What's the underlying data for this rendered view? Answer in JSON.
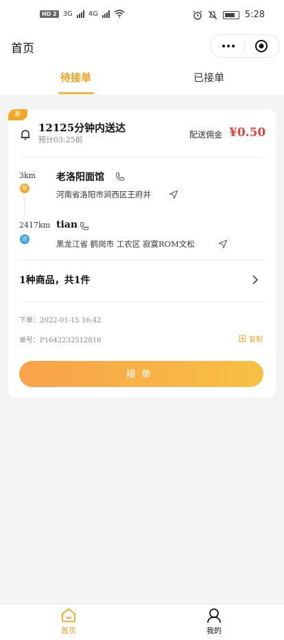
{
  "status_bar": {
    "badge": "HD 2",
    "network_1": "3G",
    "network_2": "4G",
    "time": "5:28"
  },
  "header": {
    "title": "首页"
  },
  "tabs": [
    {
      "label": "待接单",
      "active": true
    },
    {
      "label": "已接单",
      "active": false
    }
  ],
  "order": {
    "new_badge": "新",
    "delivery_title": "12125分钟内送达",
    "eta": "预计03:25前",
    "fee_label": "配送佣金",
    "fee_value": "¥0.50",
    "pickup": {
      "distance": "3km",
      "pin": "取",
      "name": "老洛阳面馆",
      "address": "河南省洛阳市涧西区王府井"
    },
    "dropoff": {
      "distance": "2417km",
      "pin": "达",
      "name": "tian",
      "address": "黑龙江省 鹤岗市 工农区 寂寞ROM文松"
    },
    "goods_summary": "1种商品，共1件",
    "order_time": "下单：2022-01-15 16:42",
    "order_number": "单号：P1642232512816",
    "copy_label": "复制",
    "accept_label": "接单"
  },
  "bottom_nav": [
    {
      "label": "首页",
      "icon": "home-icon",
      "active": true
    },
    {
      "label": "我的",
      "icon": "user-icon",
      "active": false
    }
  ],
  "colors": {
    "accent": "#f5a623",
    "price": "#e0443c",
    "deliver_pin": "#3aa0e8"
  }
}
